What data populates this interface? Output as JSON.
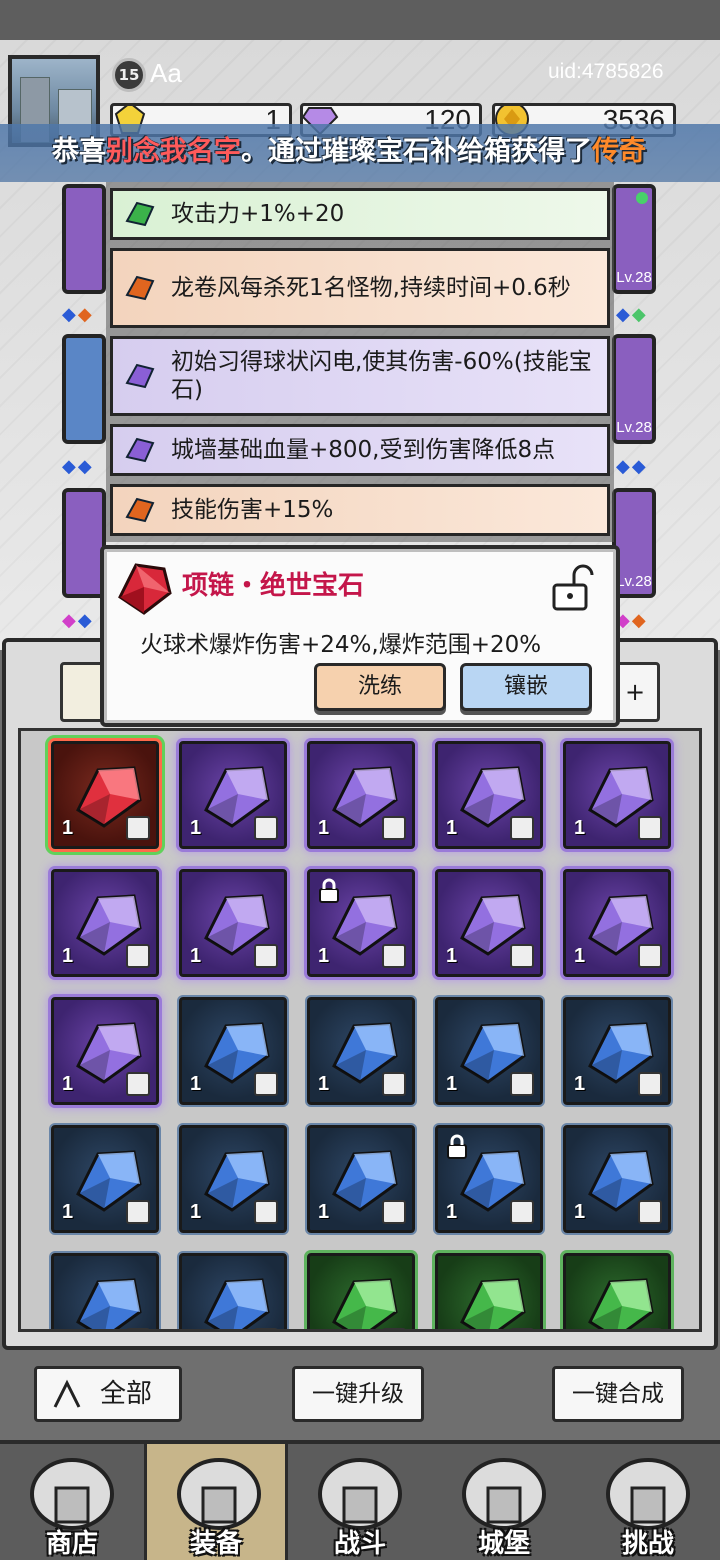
{
  "player": {
    "level": "15",
    "name": "Aa",
    "uid": "uid:4785826"
  },
  "resources": {
    "gem": "1",
    "crystal": "120",
    "gold": "3536"
  },
  "banner": {
    "prefix": "恭喜",
    "player": "别念我名字",
    "middle": "。通过璀璨宝石补给箱获得了",
    "item": "传奇"
  },
  "equipment_levels": [
    "Lv.28",
    "Lv.28",
    "Lv.28"
  ],
  "affixes": [
    {
      "color": "green",
      "text": "攻击力+1%+20"
    },
    {
      "color": "orange",
      "text": "龙卷风每杀死1名怪物,持续时间+0.6秒"
    },
    {
      "color": "purple",
      "text": "初始习得球状闪电,使其伤害-60%(技能宝石)"
    },
    {
      "color": "purple",
      "text": "城墙基础血量+800,受到伤害降低8点"
    },
    {
      "color": "orange",
      "text": "技能伤害+15%"
    }
  ],
  "detail": {
    "title": "项链・绝世宝石",
    "description": "火球术爆炸伤害+24%,爆炸范围+20%",
    "refine_label": "洗练",
    "inlay_label": "镶嵌"
  },
  "inventory_tab_right": "+",
  "inventory": [
    {
      "rarity": "red",
      "qty": "1",
      "slot": "necklace",
      "locked": false
    },
    {
      "rarity": "purple",
      "qty": "1",
      "slot": "armor",
      "locked": false
    },
    {
      "rarity": "purple",
      "qty": "1",
      "slot": "armor",
      "locked": false
    },
    {
      "rarity": "purple",
      "qty": "1",
      "slot": "armor",
      "locked": false
    },
    {
      "rarity": "purple",
      "qty": "1",
      "slot": "armor",
      "locked": false
    },
    {
      "rarity": "purple",
      "qty": "1",
      "slot": "boots",
      "locked": false
    },
    {
      "rarity": "purple",
      "qty": "1",
      "slot": "boots",
      "locked": false
    },
    {
      "rarity": "purple",
      "qty": "1",
      "slot": "weapon",
      "locked": true
    },
    {
      "rarity": "purple",
      "qty": "1",
      "slot": "weapon",
      "locked": false
    },
    {
      "rarity": "purple",
      "qty": "1",
      "slot": "weapon",
      "locked": false
    },
    {
      "rarity": "purple",
      "qty": "1",
      "slot": "necklace",
      "locked": false
    },
    {
      "rarity": "blue",
      "qty": "1",
      "slot": "ring",
      "locked": false
    },
    {
      "rarity": "blue",
      "qty": "1",
      "slot": "ring",
      "locked": false
    },
    {
      "rarity": "blue",
      "qty": "1",
      "slot": "ring",
      "locked": false
    },
    {
      "rarity": "blue",
      "qty": "1",
      "slot": "armor",
      "locked": false
    },
    {
      "rarity": "blue",
      "qty": "1",
      "slot": "boots",
      "locked": false
    },
    {
      "rarity": "blue",
      "qty": "1",
      "slot": "weapon",
      "locked": false
    },
    {
      "rarity": "blue",
      "qty": "1",
      "slot": "weapon",
      "locked": false
    },
    {
      "rarity": "blue",
      "qty": "1",
      "slot": "weapon",
      "locked": true
    },
    {
      "rarity": "blue",
      "qty": "1",
      "slot": "necklace",
      "locked": false
    },
    {
      "rarity": "blue",
      "qty": "1",
      "slot": "armor",
      "locked": false
    },
    {
      "rarity": "blue",
      "qty": "1",
      "slot": "armor",
      "locked": false
    },
    {
      "rarity": "green",
      "qty": "1",
      "slot": "armor",
      "locked": false
    },
    {
      "rarity": "green",
      "qty": "1",
      "slot": "armor",
      "locked": false
    },
    {
      "rarity": "green",
      "qty": "1",
      "slot": "armor",
      "locked": false
    }
  ],
  "actions": {
    "all": "全部",
    "upgrade_all": "一键升级",
    "merge_all": "一键合成"
  },
  "nav": [
    {
      "label": "商店",
      "icon": "shop-icon",
      "active": false
    },
    {
      "label": "装备",
      "icon": "backpack-icon",
      "active": true
    },
    {
      "label": "战斗",
      "icon": "crossed-swords-icon",
      "active": false
    },
    {
      "label": "城堡",
      "icon": "castle-icon",
      "active": false
    },
    {
      "label": "挑战",
      "icon": "shield-icon",
      "active": false
    }
  ],
  "colors": {
    "legendary_red": "#c4164a",
    "epic_purple": "#6b44a8",
    "rare_blue": "#2e4766",
    "uncommon_green": "#2d6b2d",
    "banner_highlight_name": "#ff5a5a",
    "banner_highlight_item": "#ff8a2a"
  }
}
